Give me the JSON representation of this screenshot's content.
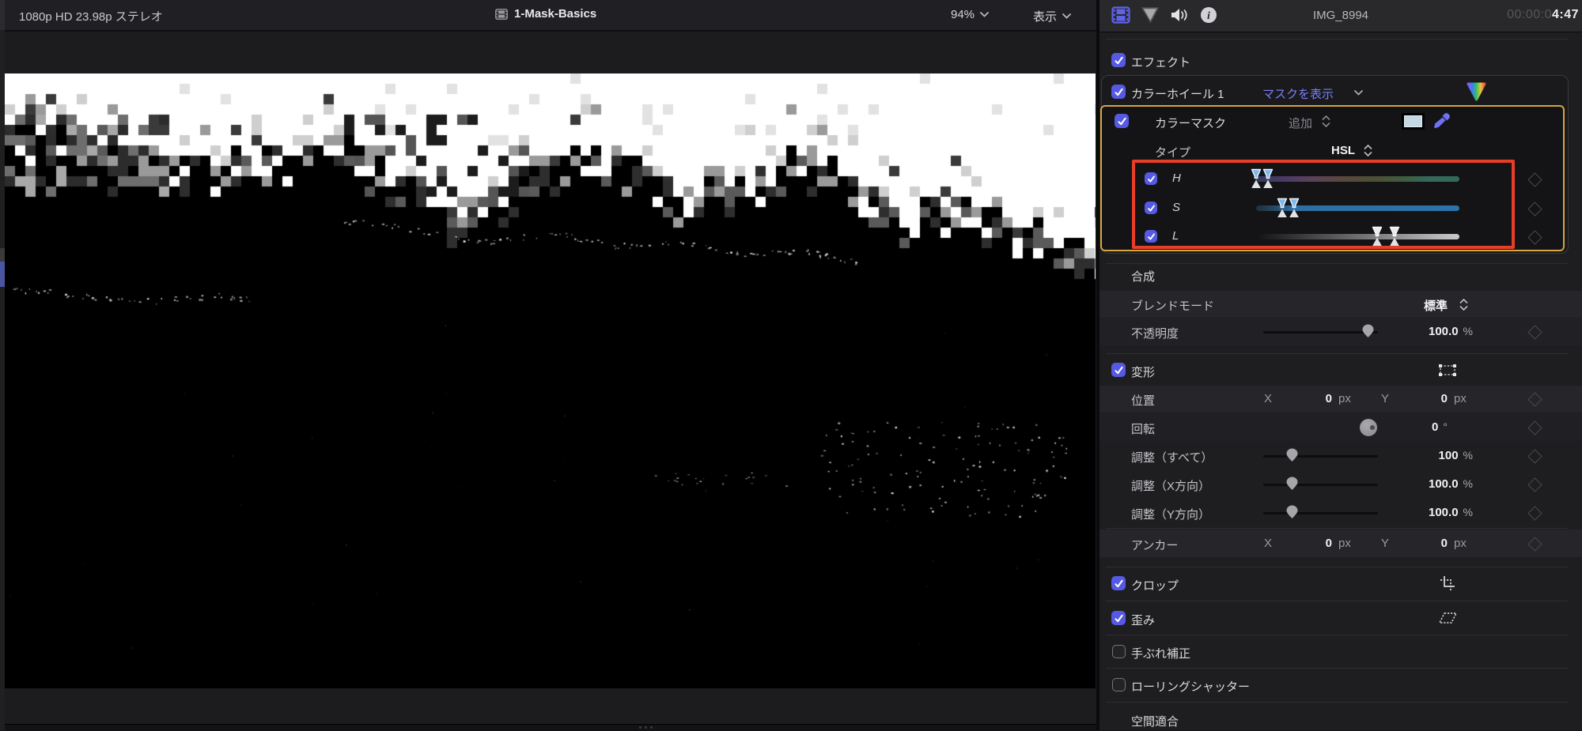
{
  "viewer_toolbar": {
    "format": "1080p HD 23.98p ステレオ",
    "title": "1-Mask-Basics",
    "zoom": "94%",
    "view": "表示"
  },
  "inspector_header": {
    "clip": "IMG_8994",
    "tc_dim": "00:00:0",
    "tc_bold": "4:47"
  },
  "effects": {
    "label": "エフェクト"
  },
  "color_wheel": {
    "label": "カラーホイール 1",
    "mask_btn": "マスクを表示"
  },
  "color_mask": {
    "label": "カラーマスク",
    "add": "追加"
  },
  "type_row": {
    "label": "タイプ",
    "value": "HSL"
  },
  "hsl_rows": [
    {
      "letter": "H"
    },
    {
      "letter": "S"
    },
    {
      "letter": "L"
    }
  ],
  "compositing": {
    "header": "合成",
    "blend_label": "ブレンドモード",
    "blend_value": "標準",
    "opacity_label": "不透明度",
    "opacity_value": "100.0",
    "opacity_unit": "%"
  },
  "transform": {
    "header": "変形",
    "axis_x": "X",
    "axis_y": "Y",
    "rows": [
      {
        "label": "位置",
        "x": "0",
        "y": "0",
        "unit": "px"
      },
      {
        "label": "回転",
        "value": "0",
        "unit": "°"
      },
      {
        "label": "調整（すべて）",
        "value": "100",
        "unit": "%"
      },
      {
        "label": "調整（X方向）",
        "value": "100.0",
        "unit": "%"
      },
      {
        "label": "調整（Y方向）",
        "value": "100.0",
        "unit": "%"
      },
      {
        "label": "アンカー",
        "x": "0",
        "y": "0",
        "unit": "px"
      }
    ]
  },
  "sections": {
    "crop": "クロップ",
    "distort": "歪み",
    "stabilization": "手ぶれ補正",
    "rolling_shutter": "ローリングシャッター",
    "spatial_conform": "空間適合"
  },
  "colors": {
    "accent_blue": "#5659e2",
    "selection_yellow": "#d7a53f",
    "annotation_red": "#e83d26",
    "link_blue": "#7b7df5",
    "mask_swatch": "#c2d8e4"
  }
}
